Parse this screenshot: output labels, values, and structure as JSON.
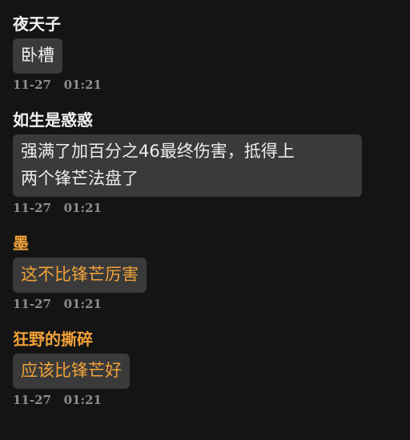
{
  "messages": [
    {
      "author": "夜天子",
      "text": "卧槽",
      "time": "11-27   01:21"
    },
    {
      "author": "如生是惑惑",
      "text_line1": "强满了加百分之46最终伤害，抵得上",
      "text_line2": "两个锋芒法盘了",
      "time": "11-27   01:21"
    },
    {
      "author": "墨",
      "text": "这不比锋芒厉害",
      "time": "11-27   01:21"
    },
    {
      "author": "狂野的撕碎",
      "text": "应该比锋芒好",
      "time": "11-27   01:21"
    }
  ],
  "colors": {
    "background": "#141414",
    "bubble": "#3a3a3a",
    "name_white": "#f2f2f2",
    "name_gold": "#f2a23a",
    "timestamp": "#8e8e8e"
  }
}
